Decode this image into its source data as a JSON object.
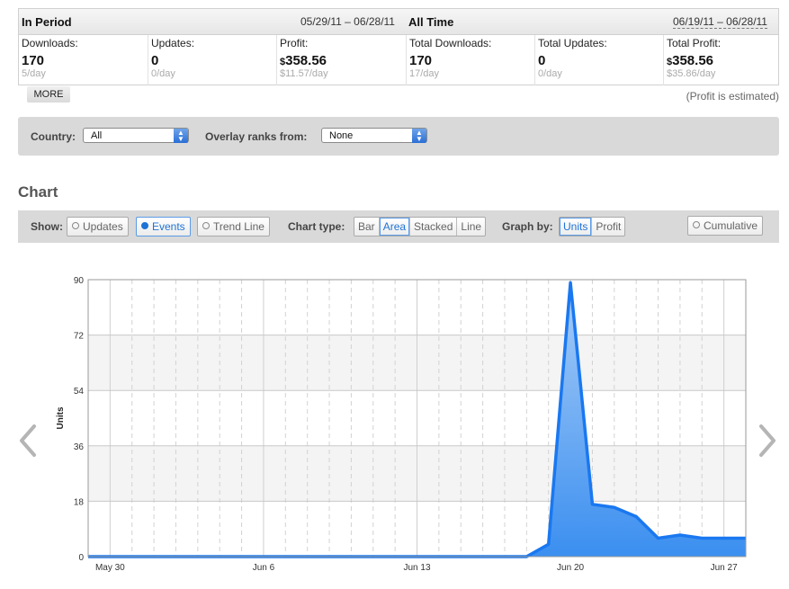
{
  "stats": {
    "in_period": {
      "title": "In Period",
      "range": "05/29/11 – 06/28/11",
      "downloads": {
        "label": "Downloads:",
        "value": "170",
        "sub": "5/day"
      },
      "updates": {
        "label": "Updates:",
        "value": "0",
        "sub": "0/day"
      },
      "profit": {
        "label": "Profit:",
        "currency": "$",
        "value": "358.56",
        "sub": "$11.57/day"
      }
    },
    "all_time": {
      "title": "All Time",
      "range": "06/19/11 – 06/28/11",
      "downloads": {
        "label": "Total Downloads:",
        "value": "170",
        "sub": "17/day"
      },
      "updates": {
        "label": "Total Updates:",
        "value": "0",
        "sub": "0/day"
      },
      "profit": {
        "label": "Total Profit:",
        "currency": "$",
        "value": "358.56",
        "sub": "$35.86/day"
      }
    },
    "more_label": "MORE",
    "estimate_note": "(Profit is estimated)"
  },
  "filters": {
    "country_label": "Country:",
    "country_value": "All",
    "overlay_label": "Overlay ranks from:",
    "overlay_value": "None"
  },
  "chart_section": {
    "title": "Chart",
    "show_label": "Show:",
    "show_updates": "Updates",
    "show_events": "Events",
    "show_trend": "Trend Line",
    "chart_type_label": "Chart type:",
    "types": [
      "Bar",
      "Area",
      "Stacked",
      "Line"
    ],
    "active_type": "Area",
    "graph_by_label": "Graph by:",
    "graph_by": [
      "Units",
      "Profit"
    ],
    "active_graph_by": "Units",
    "cumulative_label": "Cumulative"
  },
  "colors": {
    "accent": "#1f73d6",
    "area_top": "#a9cdf7",
    "area_bottom": "#3b8ff0",
    "line": "#1a78f0"
  },
  "chart_data": {
    "type": "area",
    "ylabel": "Units",
    "ylim": [
      0,
      90
    ],
    "yticks": [
      0,
      18,
      36,
      54,
      72,
      90
    ],
    "x_tick_labels": [
      {
        "label": "May 30",
        "day": 1
      },
      {
        "label": "Jun 6",
        "day": 8
      },
      {
        "label": "Jun 13",
        "day": 15
      },
      {
        "label": "Jun 20",
        "day": 22
      },
      {
        "label": "Jun 27",
        "day": 29
      }
    ],
    "x_range": [
      0,
      30
    ],
    "grid": true,
    "series": [
      {
        "x": [
          0,
          1,
          2,
          3,
          4,
          5,
          6,
          7,
          8,
          9,
          10,
          11,
          12,
          13,
          14,
          15,
          16,
          17,
          18,
          19,
          20,
          21,
          22,
          23,
          24,
          25,
          26,
          27,
          28,
          29,
          30
        ],
        "values": [
          0,
          0,
          0,
          0,
          0,
          0,
          0,
          0,
          0,
          0,
          0,
          0,
          0,
          0,
          0,
          0,
          0,
          0,
          0,
          0,
          0,
          4,
          89,
          17,
          16,
          13,
          6,
          7,
          6,
          6,
          6
        ]
      }
    ]
  }
}
